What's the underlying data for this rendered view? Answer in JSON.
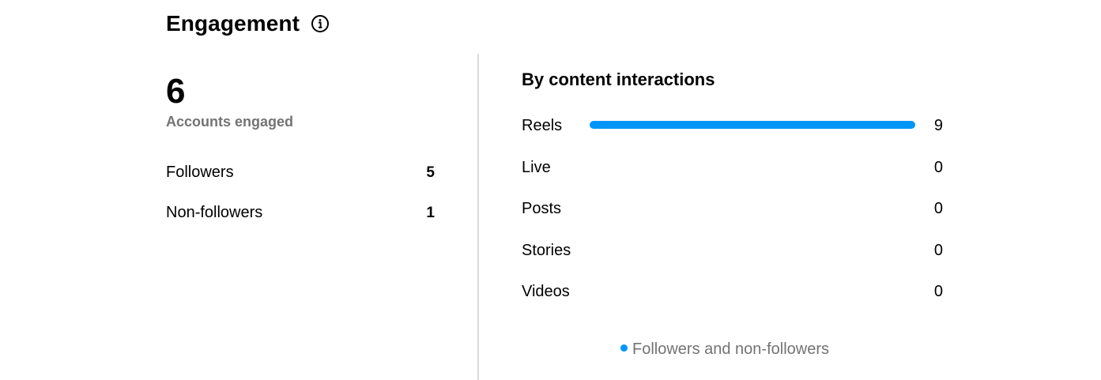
{
  "header": {
    "title": "Engagement",
    "info_icon": "info-icon"
  },
  "summary": {
    "total": "6",
    "total_label": "Accounts engaged",
    "breakdown": [
      {
        "label": "Followers",
        "value": "5"
      },
      {
        "label": "Non-followers",
        "value": "1"
      }
    ]
  },
  "content_interactions": {
    "title": "By content interactions",
    "rows": [
      {
        "label": "Reels",
        "value": "9",
        "fraction": 1.0
      },
      {
        "label": "Live",
        "value": "0",
        "fraction": 0
      },
      {
        "label": "Posts",
        "value": "0",
        "fraction": 0
      },
      {
        "label": "Stories",
        "value": "0",
        "fraction": 0
      },
      {
        "label": "Videos",
        "value": "0",
        "fraction": 0
      }
    ],
    "legend": "Followers and non-followers",
    "bar_color": "#0095f6"
  }
}
